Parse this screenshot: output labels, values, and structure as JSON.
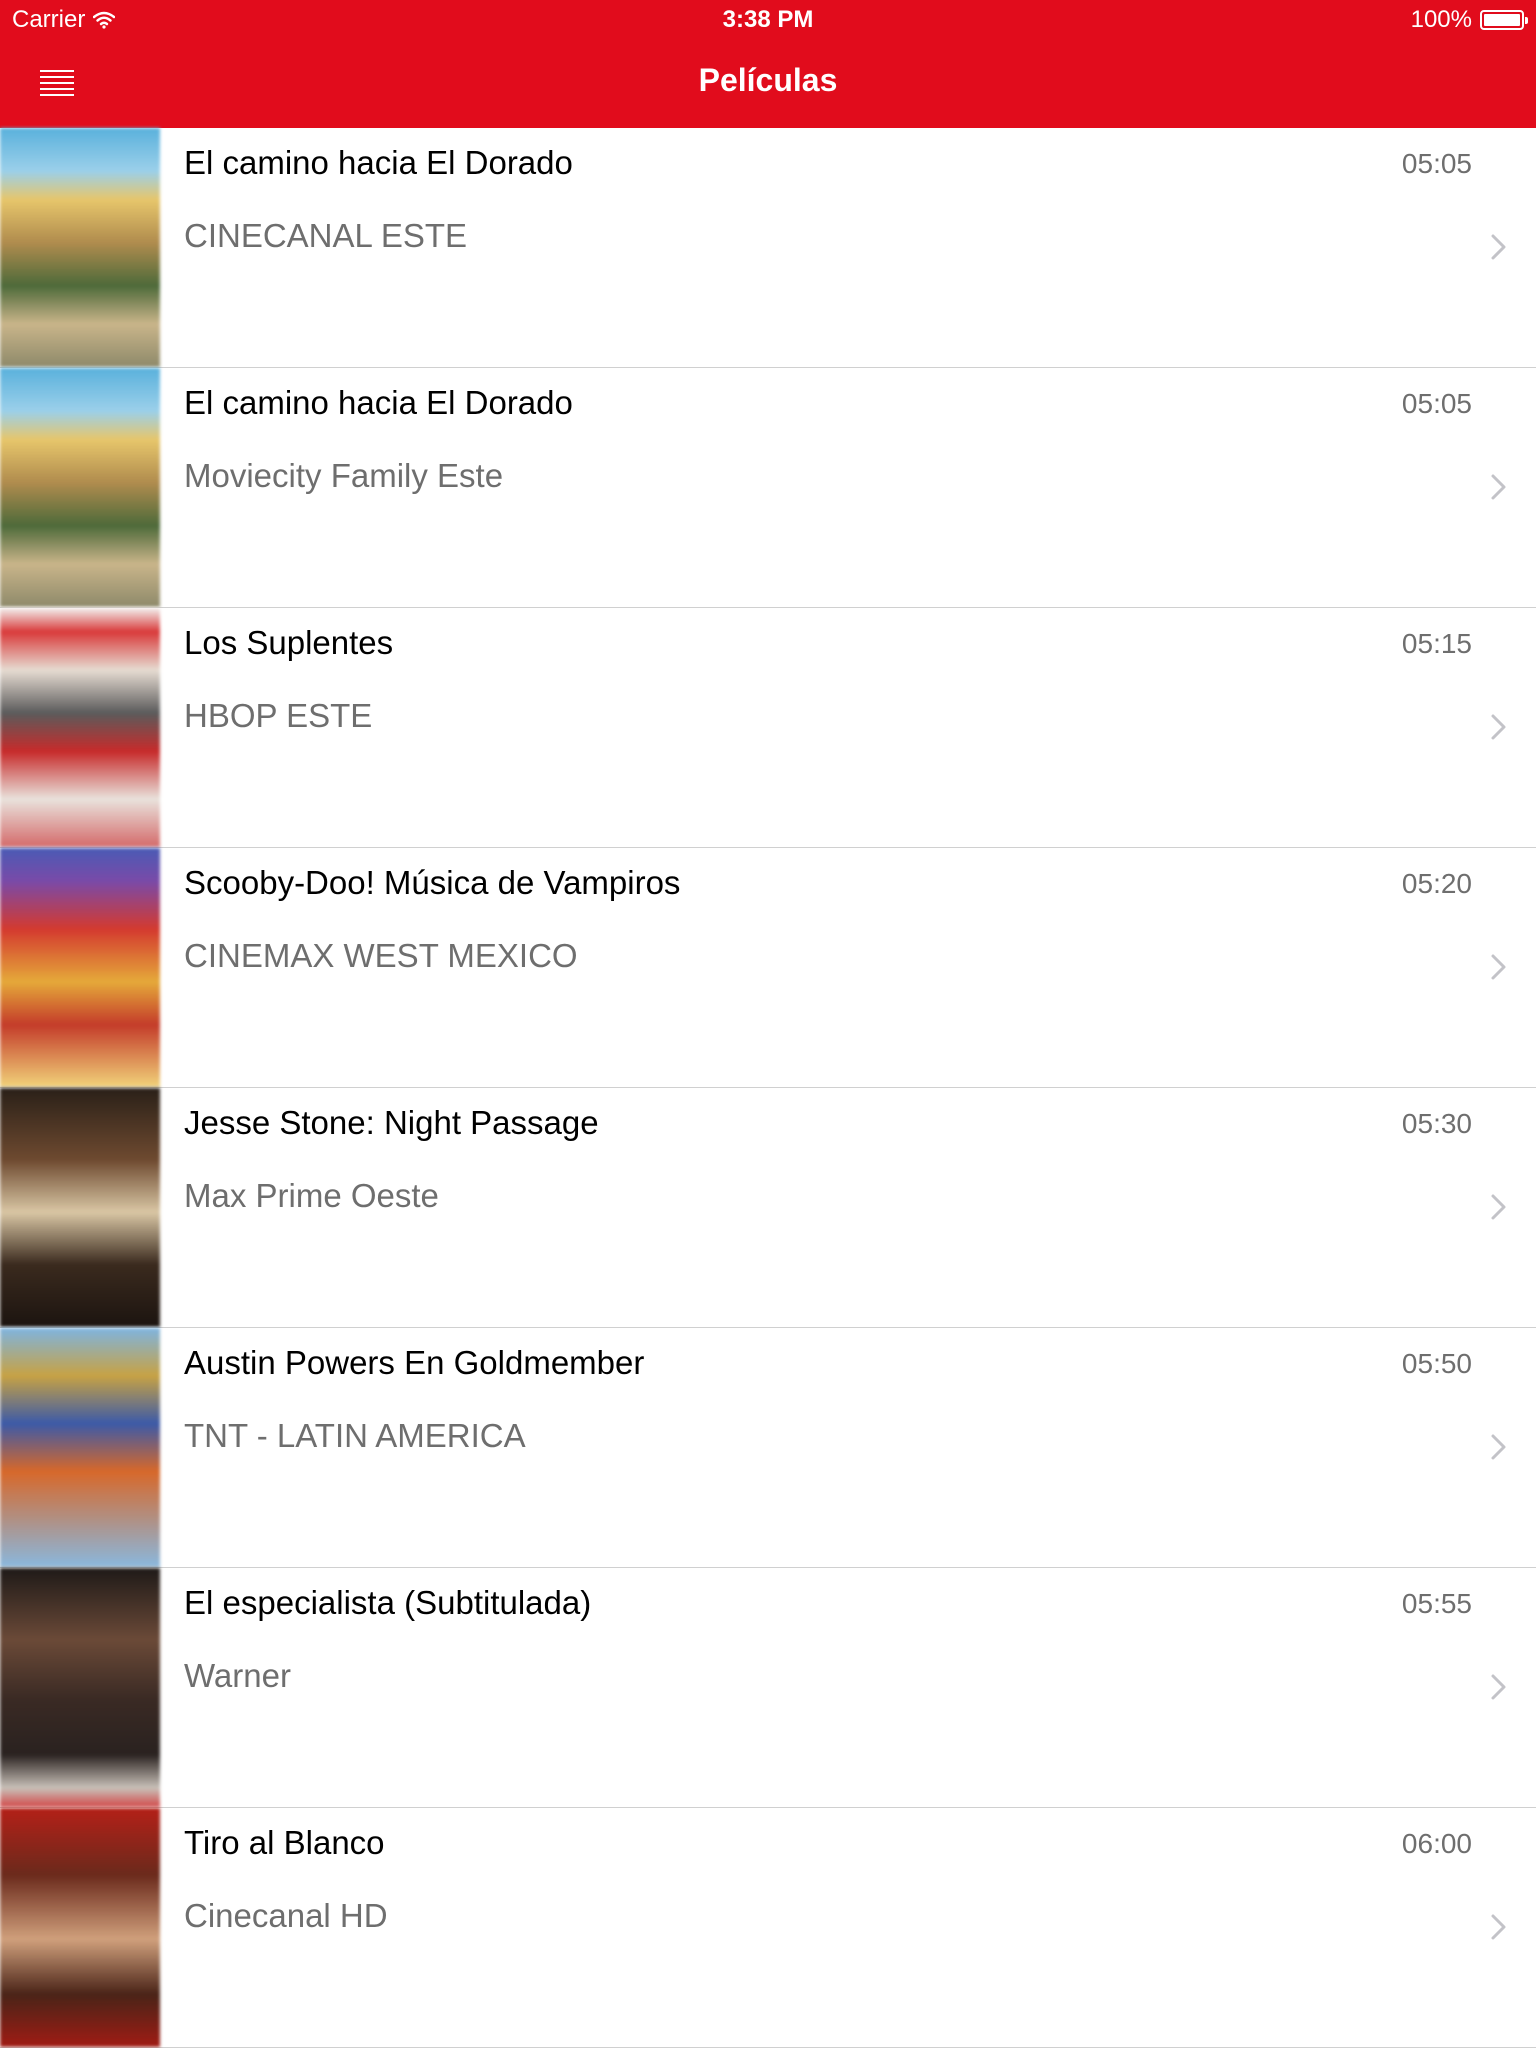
{
  "status_bar": {
    "carrier": "Carrier",
    "time": "3:38 PM",
    "battery": "100%",
    "battery_level": 1.0
  },
  "header": {
    "title": "Películas",
    "menu_icon": "hamburger-menu-icon"
  },
  "colors": {
    "accent": "#e10c1c",
    "secondary_text": "#6e6e6e",
    "separator": "#d0d0d0"
  },
  "movies": [
    {
      "title": "El camino hacia El Dorado",
      "channel": "CINECANAL ESTE",
      "time": "05:05"
    },
    {
      "title": "El camino hacia El Dorado",
      "channel": "Moviecity Family Este",
      "time": "05:05"
    },
    {
      "title": "Los Suplentes",
      "channel": "HBOP ESTE",
      "time": "05:15"
    },
    {
      "title": "Scooby-Doo! Música de Vampiros",
      "channel": "CINEMAX WEST MEXICO",
      "time": "05:20"
    },
    {
      "title": "Jesse Stone: Night Passage",
      "channel": "Max Prime Oeste",
      "time": "05:30"
    },
    {
      "title": "Austin Powers En Goldmember",
      "channel": "TNT - LATIN AMERICA",
      "time": "05:50"
    },
    {
      "title": "El especialista (Subtitulada)",
      "channel": "Warner",
      "time": "05:55"
    },
    {
      "title": "Tiro al Blanco",
      "channel": "Cinecanal HD",
      "time": "06:00"
    }
  ]
}
